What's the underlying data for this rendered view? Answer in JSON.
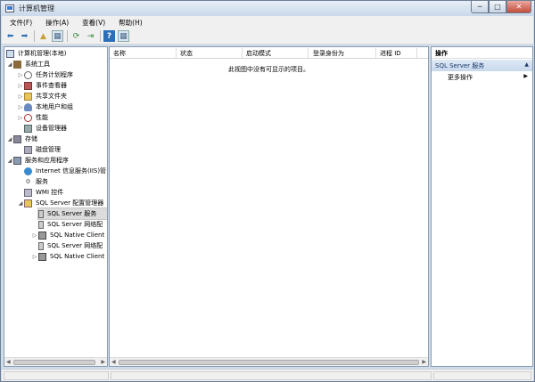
{
  "window": {
    "title": "计算机管理",
    "controls": {
      "minimize": "─",
      "maximize": "□",
      "close": "✕"
    }
  },
  "menu": [
    "文件(F)",
    "操作(A)",
    "查看(V)",
    "帮助(H)"
  ],
  "toolbar": [
    {
      "name": "back-icon",
      "glyph": "⬅",
      "color": "#2c6fb8"
    },
    {
      "name": "forward-icon",
      "glyph": "➡",
      "color": "#2c6fb8"
    },
    {
      "name": "up-folder-icon",
      "glyph": "▲",
      "color": "#c7a23a"
    },
    {
      "name": "show-hide-tree-icon",
      "glyph": "▦",
      "color": "#4a6a8a"
    },
    {
      "name": "refresh-icon",
      "glyph": "⟳",
      "color": "#3a8a3a"
    },
    {
      "name": "export-list-icon",
      "glyph": "⇥",
      "color": "#3a8a3a"
    },
    {
      "name": "help-icon",
      "glyph": "?",
      "color": "#ffffff"
    },
    {
      "name": "show-hide-action-pane-icon",
      "glyph": "▦",
      "color": "#4a6a8a"
    }
  ],
  "tree": {
    "root": "计算机管理(本地)",
    "system_tools": "系统工具",
    "task_scheduler": "任务计划程序",
    "event_viewer": "事件查看器",
    "shared_folders": "共享文件夹",
    "local_users": "本地用户和组",
    "performance": "性能",
    "device_manager": "设备管理器",
    "storage": "存储",
    "disk_mgmt": "磁盘管理",
    "services_apps": "服务和应用程序",
    "iis": "Internet 信息服务(IIS)管",
    "services": "服务",
    "wmi": "WMI 控件",
    "sql_config": "SQL Server 配置管理器",
    "sql_services": "SQL Server 服务",
    "sql_network": "SQL Server 网络配",
    "sql_native1": "SQL Native Client",
    "sql_network2": "SQL Server 网络配",
    "sql_native2": "SQL Native Client"
  },
  "columns": [
    "名称",
    "状态",
    "启动模式",
    "登录身份为",
    "进程 ID"
  ],
  "empty_message": "此视图中没有可显示的项目。",
  "actions": {
    "header": "操作",
    "section": "SQL Server 服务",
    "more": "更多操作",
    "more_arrow": "▶"
  },
  "colors": {
    "selection": "#dcdcdc",
    "frame": "#cfdcea",
    "accent": "#2c6fb8"
  }
}
